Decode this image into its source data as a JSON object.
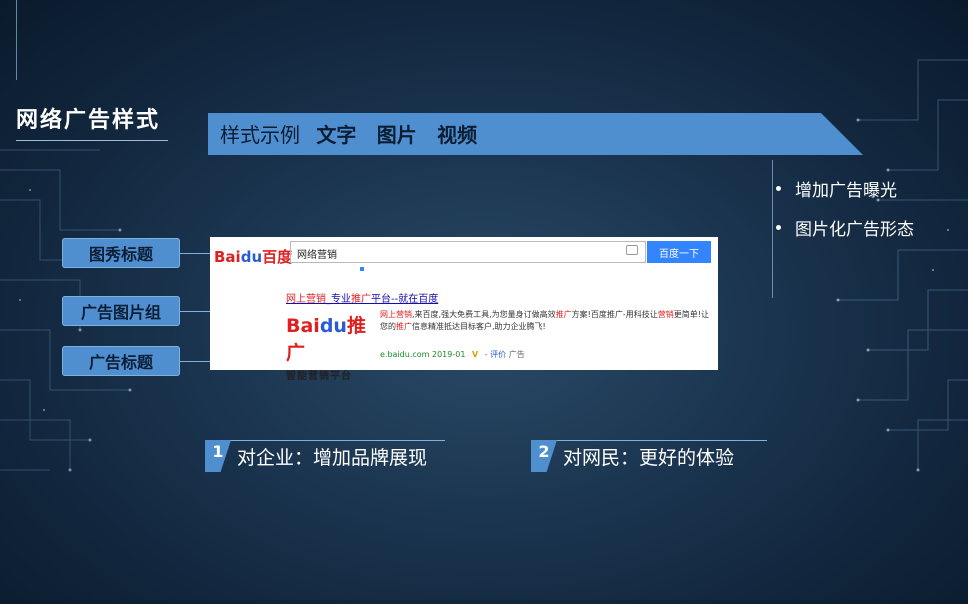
{
  "title": "网络广告样式",
  "banner": {
    "lead": "样式示例",
    "items": [
      "文字",
      "图片",
      "视频"
    ]
  },
  "bullets": [
    "增加广告曝光",
    "图片化广告形态"
  ],
  "tags": [
    "图秀标题",
    "广告图片组",
    "广告标题"
  ],
  "search": {
    "logo_bai": "Bai",
    "logo_du": "du",
    "logo_cn": "百度",
    "query": "网络营销",
    "button": "百度一下",
    "ad_title_red1": "网上营销",
    "ad_title_mid": "_专业",
    "ad_title_red2": "推广",
    "ad_title_rest": "平台--就在百度",
    "ad_logo_bai": "Bai",
    "ad_logo_du": "du",
    "ad_logo_cn": "推广",
    "ad_slogan": "智能营销平台",
    "desc_red1": "网上营销",
    "desc_1": ",来百度,强大免费工具,为您量身订做高效",
    "desc_red2": "推广",
    "desc_2": "方案!百度推广-用科技让",
    "desc_red3": "营销",
    "desc_3": "更简单!让您的",
    "desc_red4": "推广",
    "desc_4": "信息精准抵达目标客户,助力企业腾飞!",
    "url": "e.baidu.com",
    "date": "2019-01",
    "v": "V",
    "review": "评价",
    "ad": "广告"
  },
  "points": [
    {
      "num": "1",
      "text": "对企业：增加品牌展现"
    },
    {
      "num": "2",
      "text": "对网民：更好的体验"
    }
  ],
  "colors": {
    "accent": "#4f8fd0",
    "background": "#1b3550"
  }
}
